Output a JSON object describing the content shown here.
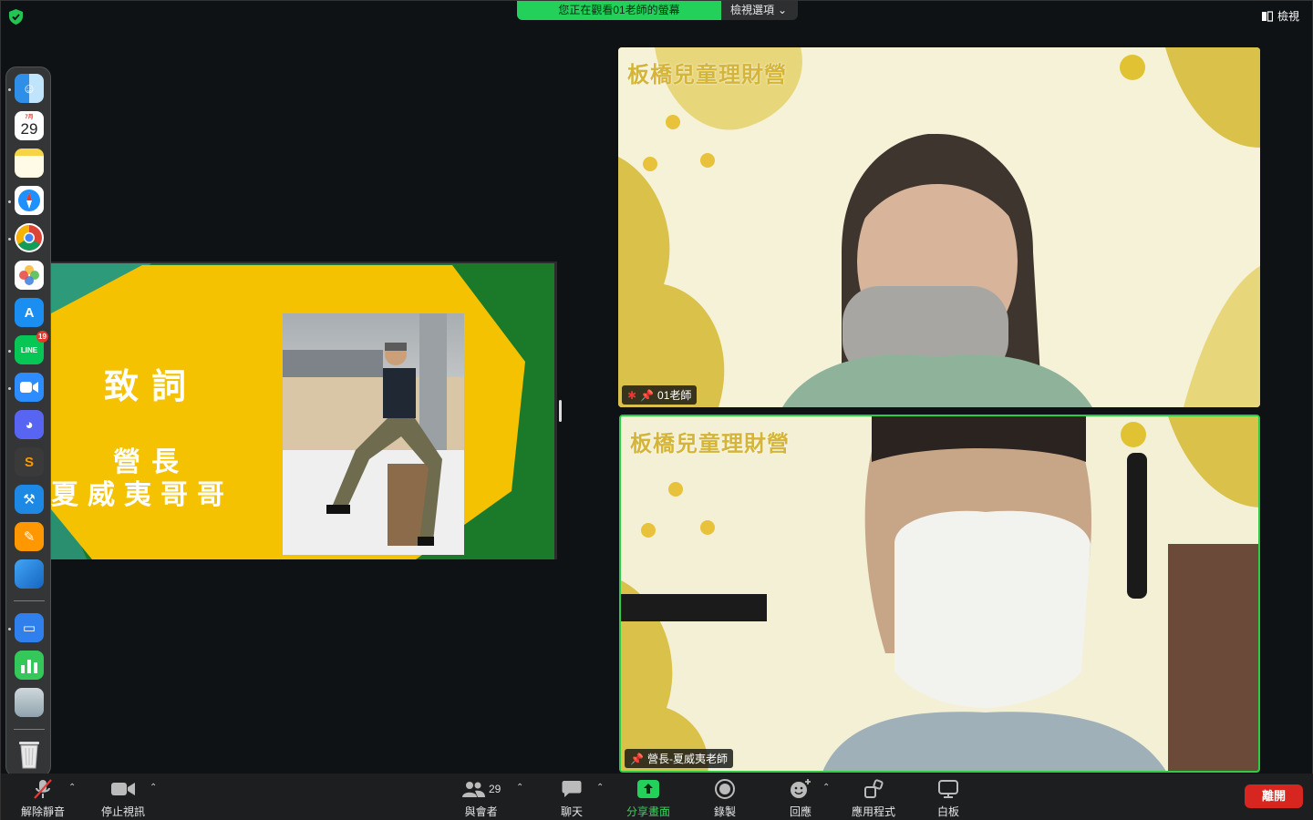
{
  "top_bar": {
    "security_icon": "shield-check-icon",
    "share_banner_text": "您正在觀看01老師的螢幕",
    "view_options_label": "檢視選項",
    "view_label": "檢視"
  },
  "dock": {
    "calendar_month": "7月",
    "calendar_day": "29",
    "line_badge": "19",
    "items": [
      "finder-icon",
      "calendar-icon",
      "notes-icon",
      "safari-icon",
      "chrome-icon",
      "photos-icon",
      "app-store-icon",
      "line-icon",
      "zoom-icon",
      "discord-icon",
      "sublime-icon",
      "xcode-icon",
      "pages-icon",
      "migration-icon",
      "keynote-icon",
      "numbers-icon",
      "preview-icon",
      "trash-icon"
    ]
  },
  "slide": {
    "title": "致詞",
    "role": "營長",
    "person": "夏威夷哥哥"
  },
  "videos": [
    {
      "brand": "板橋兒童理財營",
      "name": "01老師"
    },
    {
      "brand": "板橋兒童理財營",
      "name": "營長-夏威夷老師"
    }
  ],
  "toolbar": {
    "unmute_label": "解除靜音",
    "stop_video_label": "停止視訊",
    "participants_label": "與會者",
    "participants_count": "29",
    "chat_label": "聊天",
    "share_label": "分享畫面",
    "record_label": "錄製",
    "reactions_label": "回應",
    "apps_label": "應用程式",
    "whiteboard_label": "白板",
    "leave_label": "離開"
  },
  "colors": {
    "share_green": "#22d05a",
    "leave_red": "#d6261f",
    "active_speaker_border": "#2ecc40",
    "slide_yellow": "#f4c200",
    "slide_green": "#1a7a2a"
  }
}
